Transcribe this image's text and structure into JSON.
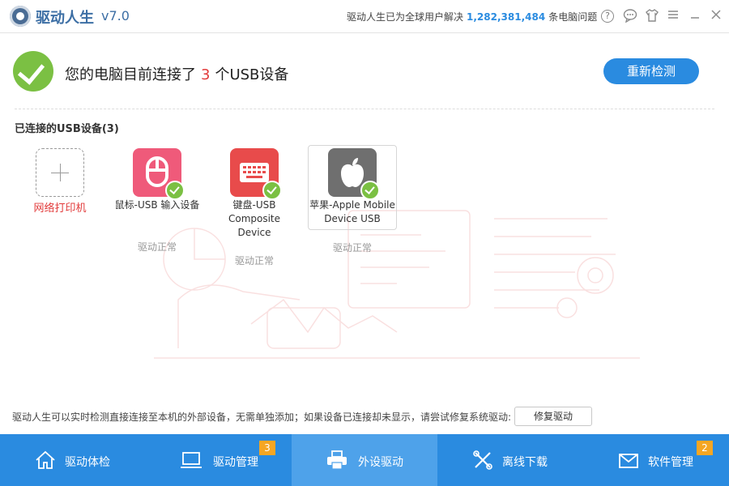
{
  "app": {
    "name": "驱动人生",
    "version": "v7.0"
  },
  "titlebar": {
    "notice_prefix": "驱动人生已为全球用户解决",
    "notice_count": "1,282,381,484",
    "notice_suffix": "条电脑问题"
  },
  "status": {
    "text_prefix": "您的电脑目前连接了",
    "count": "3",
    "text_suffix": "个USB设备",
    "rescan_label": "重新检测"
  },
  "section": {
    "title": "已连接的USB设备(3)"
  },
  "devices": [
    {
      "name": "网络打印机",
      "icon": "add-icon"
    },
    {
      "name": "鼠标-USB 输入设备",
      "icon": "mouse-icon",
      "status": "驱动正常"
    },
    {
      "name": "键盘-USB Composite Device",
      "icon": "keyboard-icon",
      "status": "驱动正常"
    },
    {
      "name": "苹果-Apple Mobile Device USB",
      "icon": "apple-icon",
      "status": "驱动正常"
    }
  ],
  "footer": {
    "hint": "驱动人生可以实时检测直接连接至本机的外部设备，无需单独添加；如果设备已连接却未显示，请尝试修复系统驱动:",
    "repair_label": "修复驱动"
  },
  "nav": [
    {
      "label": "驱动体检",
      "icon": "home-icon"
    },
    {
      "label": "驱动管理",
      "icon": "monitor-icon",
      "badge": "3"
    },
    {
      "label": "外设驱动",
      "icon": "printer-icon",
      "active": true
    },
    {
      "label": "离线下载",
      "icon": "tools-icon"
    },
    {
      "label": "软件管理",
      "icon": "mail-icon",
      "badge": "2"
    }
  ],
  "colors": {
    "accent": "#2a8be0",
    "ok_green": "#7bc043",
    "alert_red": "#e23c3c",
    "badge_orange": "#f5a623"
  }
}
